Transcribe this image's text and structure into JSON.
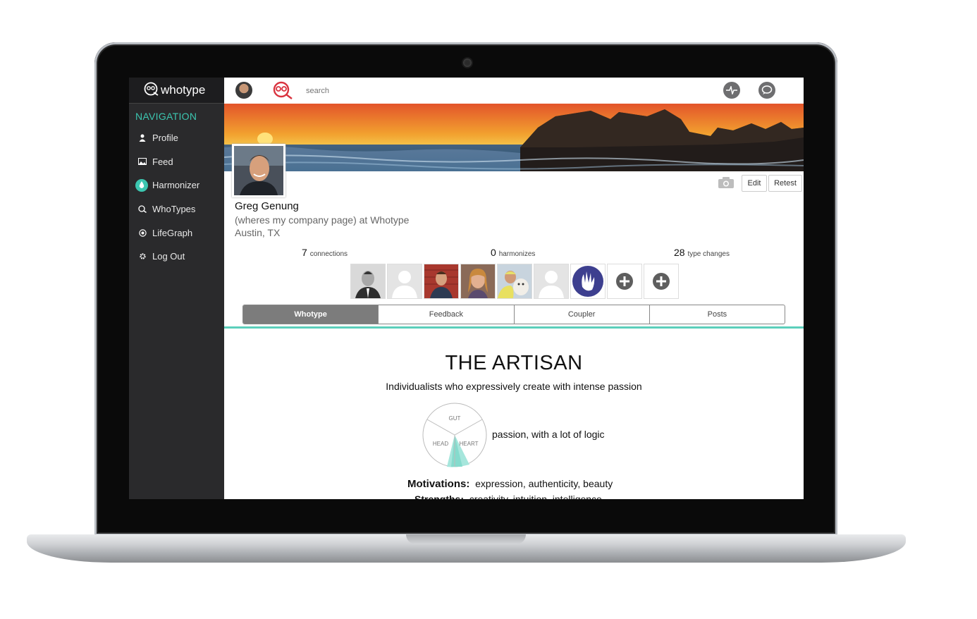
{
  "sidebar": {
    "brand": "whotype",
    "nav_title": "NAVIGATION",
    "items": [
      {
        "label": "Profile",
        "icon": "user-icon"
      },
      {
        "label": "Feed",
        "icon": "image-icon"
      },
      {
        "label": "Harmonizer",
        "icon": "drop-icon"
      },
      {
        "label": "WhoTypes",
        "icon": "owl-icon"
      },
      {
        "label": "LifeGraph",
        "icon": "target-icon"
      },
      {
        "label": "Log Out",
        "icon": "gear-icon"
      }
    ]
  },
  "topbar": {
    "search_placeholder": "search",
    "icons": [
      "avatar",
      "owl-icon",
      "pulse-icon",
      "chat-icon"
    ]
  },
  "profile": {
    "name": "Greg Genung",
    "company_line": "(wheres my company page) at Whotype",
    "location": "Austin, TX",
    "buttons": {
      "edit": "Edit",
      "retest": "Retest"
    },
    "stats": [
      {
        "value": "7",
        "label": "connections"
      },
      {
        "value": "0",
        "label": "harmonizes"
      },
      {
        "value": "28",
        "label": "type changes"
      }
    ]
  },
  "tabs": [
    "Whotype",
    "Feedback",
    "Coupler",
    "Posts"
  ],
  "active_tab": "Whotype",
  "whotype": {
    "title": "THE ARTISAN",
    "description": "Individualists who expressively create with intense passion",
    "wheel": {
      "gut": "GUT",
      "head": "HEAD",
      "heart": "HEART"
    },
    "wheel_caption": "passion, with a lot of logic",
    "motivations_label": "Motivations:",
    "motivations": "expression, authenticity, beauty",
    "strengths_label": "Strengths:",
    "strengths": "creativity, intuition, intelligence"
  },
  "colors": {
    "accent": "#3cc6b0",
    "sidebar": "#2a2a2c",
    "tab_active": "#7c7c7c"
  }
}
